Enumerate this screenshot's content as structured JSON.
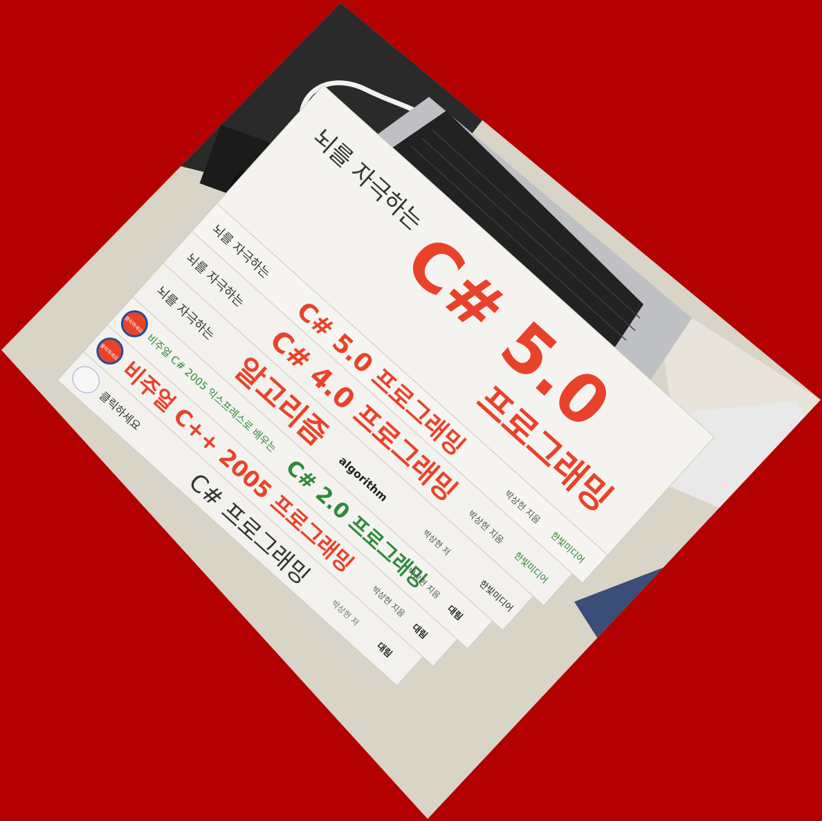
{
  "colors": {
    "frame": "#b30000",
    "spine": "#f3f2ee",
    "accent_red": "#e8432a",
    "accent_green": "#2e8a3a"
  },
  "books": [
    {
      "series": "뇌를 자극하는",
      "title": "C# 5.0 프로그래밍",
      "author": "박상현 지음",
      "publisher": "한빛미디어",
      "cover_title": "C# 5.0",
      "cover_subtitle": "프로그래밍",
      "cover_series": "뇌를 자극하는"
    },
    {
      "series": "뇌를 자극하는",
      "title": "C# 4.0 프로그래밍",
      "author": "박상현 지음",
      "publisher": "한빛미디어"
    },
    {
      "series": "뇌를 자극하는",
      "title": "알고리즘",
      "subtitle": "algorithm",
      "author": "박상현 저",
      "publisher": "한빛미디어"
    },
    {
      "badge": "클릭하세요",
      "series": "비주얼 C# 2005 익스프레스로 배우는",
      "title": "C# 2.0 프로그래밍",
      "author": "박상현 지음",
      "publisher": "대림"
    },
    {
      "badge": "클릭하세요",
      "title": "비주얼 C++ 2005 프로그래밍",
      "author": "박상현 지음",
      "publisher": "대림"
    },
    {
      "series": "클릭하세요",
      "title": "C# 프로그래밍",
      "author": "박상현 저",
      "publisher": "대림"
    }
  ]
}
